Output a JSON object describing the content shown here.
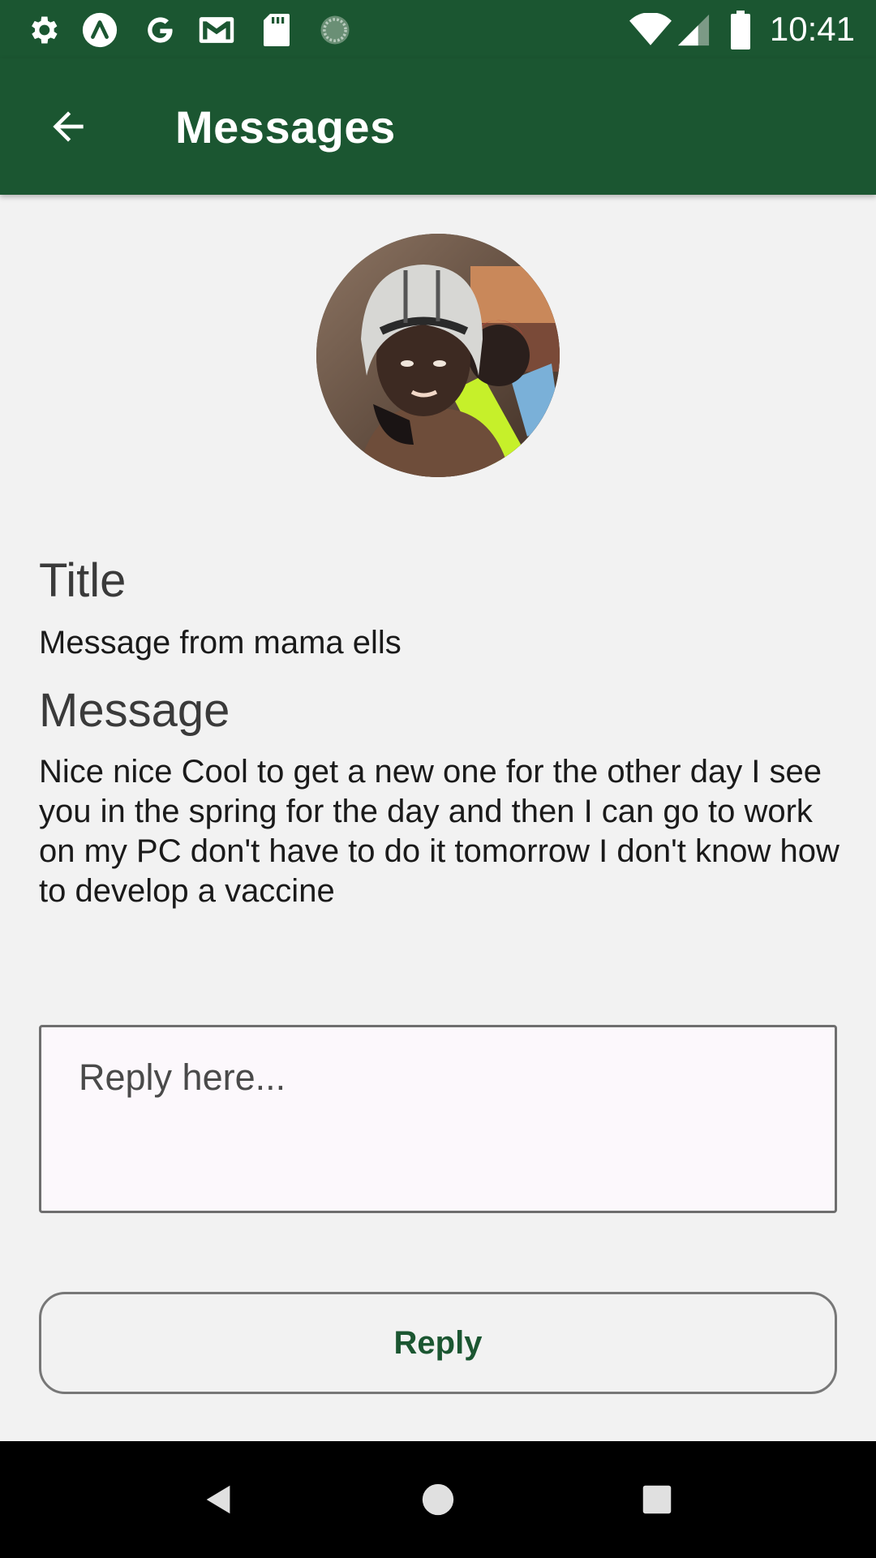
{
  "status_bar": {
    "time": "10:41",
    "left_icons": [
      "gear-icon",
      "app-circle-icon",
      "google-icon",
      "gmail-icon",
      "sd-card-icon",
      "loading-icon"
    ],
    "right_icons": [
      "wifi-icon",
      "cell-signal-icon",
      "battery-icon"
    ]
  },
  "app_bar": {
    "title": "Messages",
    "back_icon": "arrow-back-icon"
  },
  "message": {
    "title_label": "Title",
    "title_value": "Message from mama ells",
    "message_label": "Message",
    "message_value": "Nice nice Cool to get a new one for the other day I see you in the spring for the day and then I can go to work on my PC don't have to do it tomorrow I don't know how to develop a vaccine"
  },
  "reply": {
    "placeholder": "Reply here...",
    "value": "",
    "button_label": "Reply"
  },
  "nav_bar": {
    "icons": [
      "nav-back-icon",
      "nav-home-icon",
      "nav-recents-icon"
    ]
  },
  "colors": {
    "primary": "#1b5631",
    "background": "#f2f2f2",
    "input_background": "#fcf8fc",
    "nav_bar": "#000000"
  }
}
